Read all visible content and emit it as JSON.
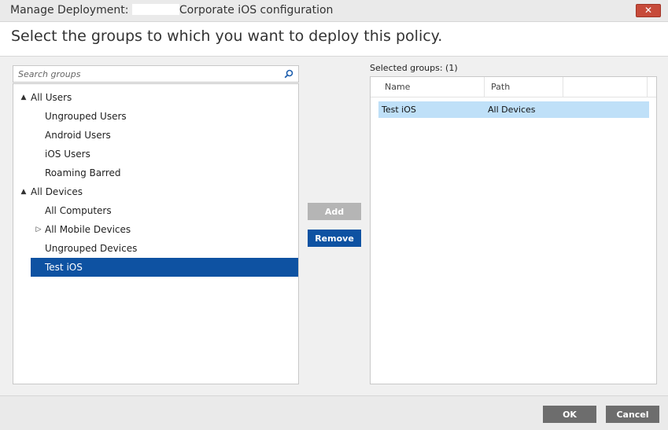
{
  "window": {
    "title_prefix": "Manage Deployment: ",
    "title_suffix": "Corporate iOS configuration",
    "close_glyph": "✕"
  },
  "instruction": "Select the groups to which you want to deploy this policy.",
  "search": {
    "placeholder": "Search groups",
    "icon": "search-icon"
  },
  "tree": {
    "nodes": [
      {
        "label": "All Users",
        "level": 0,
        "expander": "▲"
      },
      {
        "label": "Ungrouped Users",
        "level": 1
      },
      {
        "label": "Android Users",
        "level": 1
      },
      {
        "label": "iOS Users",
        "level": 1
      },
      {
        "label": "Roaming Barred",
        "level": 1
      },
      {
        "label": "All Devices",
        "level": 0,
        "expander": "▲"
      },
      {
        "label": "All Computers",
        "level": 1
      },
      {
        "label": "All Mobile Devices",
        "level": 1,
        "expander": "▷"
      },
      {
        "label": "Ungrouped Devices",
        "level": 1
      },
      {
        "label": "Test iOS",
        "level": 1,
        "selected": true
      }
    ]
  },
  "actions": {
    "add": "Add",
    "remove": "Remove"
  },
  "selected_groups": {
    "label": "Selected groups: (1)",
    "columns": [
      "Name",
      "Path"
    ],
    "rows": [
      {
        "name": "Test iOS",
        "path": "All Devices"
      }
    ]
  },
  "footer": {
    "ok": "OK",
    "cancel": "Cancel"
  },
  "colors": {
    "accent": "#0e52a2",
    "selection_row": "#bfe0f8",
    "close": "#c74b3a",
    "disabled": "#b5b5b5",
    "footer_button": "#6d6d6d"
  }
}
